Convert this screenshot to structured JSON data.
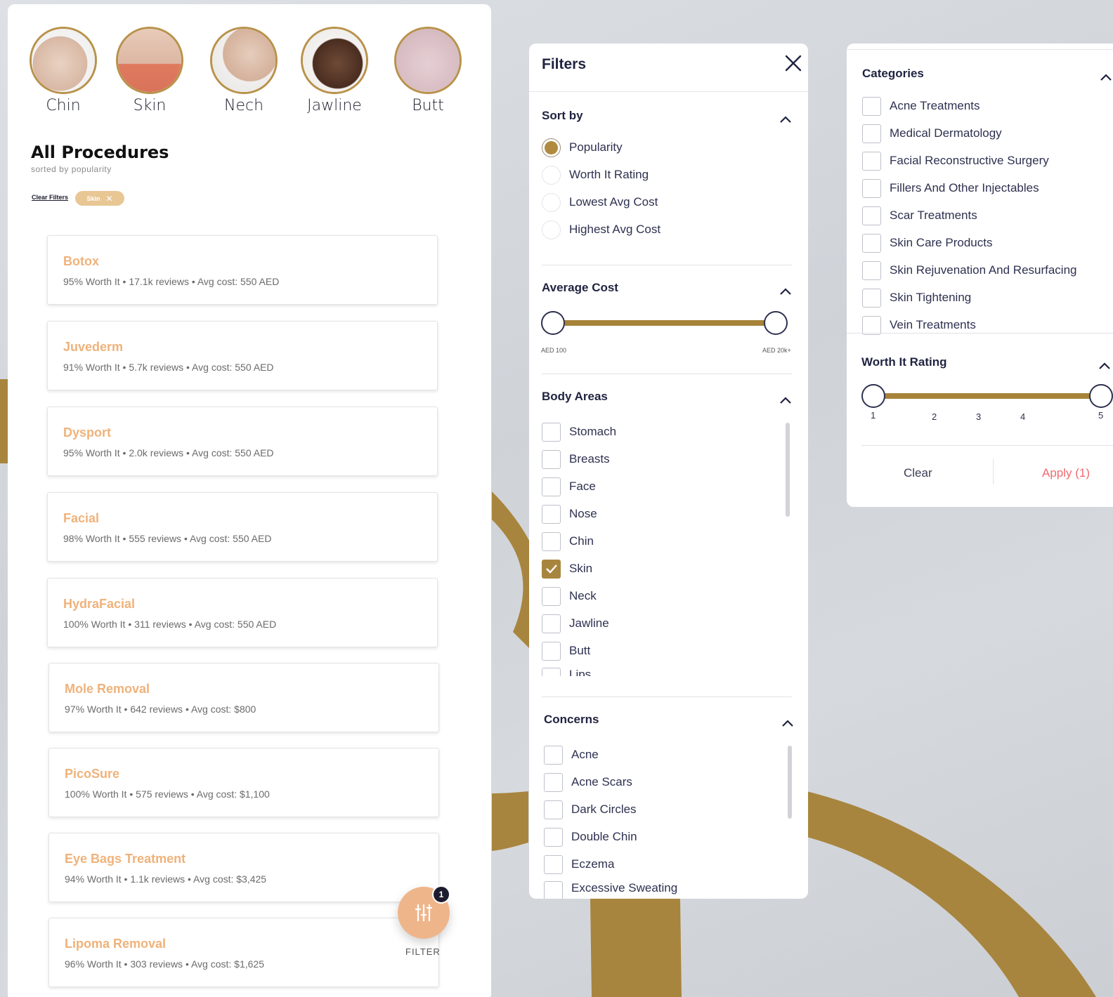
{
  "left": {
    "body_areas": [
      {
        "label": "Chin"
      },
      {
        "label": "Skin"
      },
      {
        "label": "Nech"
      },
      {
        "label": "Jawline"
      },
      {
        "label": "Butt"
      }
    ],
    "title": "All Procedures",
    "subtitle": "sorted by popularity",
    "clear_filters": "Clear Filters",
    "active_chip": "Skin",
    "procedures": [
      {
        "name": "Botox",
        "meta": "95% Worth It • 17.1k reviews • Avg cost: 550 AED"
      },
      {
        "name": "Juvederm",
        "meta": "91% Worth It • 5.7k reviews • Avg cost: 550 AED"
      },
      {
        "name": "Dysport",
        "meta": "95% Worth It • 2.0k reviews • Avg cost: 550 AED"
      },
      {
        "name": "Facial",
        "meta": "98% Worth It • 555 reviews • Avg cost: 550 AED"
      },
      {
        "name": "HydraFacial",
        "meta": "100% Worth It • 311 reviews • Avg cost: 550 AED"
      },
      {
        "name": "Mole Removal",
        "meta": "97% Worth It • 642 reviews • Avg cost: $800"
      },
      {
        "name": "PicoSure",
        "meta": "100% Worth It • 575 reviews • Avg cost: $1,100"
      },
      {
        "name": "Eye Bags Treatment",
        "meta": "94% Worth It • 1.1k reviews • Avg cost: $3,425"
      },
      {
        "name": "Lipoma Removal",
        "meta": "96% Worth It • 303 reviews • Avg cost: $1,625"
      }
    ],
    "fab": {
      "badge": "1",
      "label": "FILTER"
    }
  },
  "filters": {
    "title": "Filters",
    "sort_by": {
      "title": "Sort by",
      "options": [
        {
          "label": "Popularity",
          "selected": true
        },
        {
          "label": "Worth It Rating",
          "selected": false
        },
        {
          "label": "Lowest Avg Cost",
          "selected": false
        },
        {
          "label": "Highest Avg Cost",
          "selected": false
        }
      ]
    },
    "average_cost": {
      "title": "Average Cost",
      "min_label": "AED 100",
      "max_label": "AED 20k+"
    },
    "body_areas": {
      "title": "Body Areas",
      "options": [
        {
          "label": "Stomach",
          "checked": false
        },
        {
          "label": "Breasts",
          "checked": false
        },
        {
          "label": "Face",
          "checked": false
        },
        {
          "label": "Nose",
          "checked": false
        },
        {
          "label": "Chin",
          "checked": false
        },
        {
          "label": "Skin",
          "checked": true
        },
        {
          "label": "Neck",
          "checked": false
        },
        {
          "label": "Jawline",
          "checked": false
        },
        {
          "label": "Butt",
          "checked": false
        },
        {
          "label": "Lips",
          "checked": false
        }
      ]
    },
    "concerns": {
      "title": "Concerns",
      "options": [
        {
          "label": "Acne",
          "checked": false
        },
        {
          "label": "Acne Scars",
          "checked": false
        },
        {
          "label": "Dark Circles",
          "checked": false
        },
        {
          "label": "Double Chin",
          "checked": false
        },
        {
          "label": "Eczema",
          "checked": false
        },
        {
          "label": "Excessive Sweating",
          "checked": false
        }
      ]
    }
  },
  "categories": {
    "title": "Categories",
    "options": [
      {
        "label": "Acne Treatments"
      },
      {
        "label": "Medical Dermatology"
      },
      {
        "label": "Facial Reconstructive Surgery"
      },
      {
        "label": "Fillers And Other Injectables"
      },
      {
        "label": "Scar Treatments"
      },
      {
        "label": "Skin Care Products"
      },
      {
        "label": "Skin Rejuvenation And Resurfacing"
      },
      {
        "label": "Skin Tightening"
      },
      {
        "label": "Vein Treatments"
      }
    ],
    "worth_it": {
      "title": "Worth It Rating",
      "ticks": [
        "1",
        "2",
        "3",
        "4",
        "5"
      ]
    },
    "clear": "Clear",
    "apply": "Apply (1)"
  },
  "colors": {
    "gold": "#a68339",
    "peach": "#efb27a",
    "navy": "#1f2340",
    "apply_red": "#f16a70"
  }
}
